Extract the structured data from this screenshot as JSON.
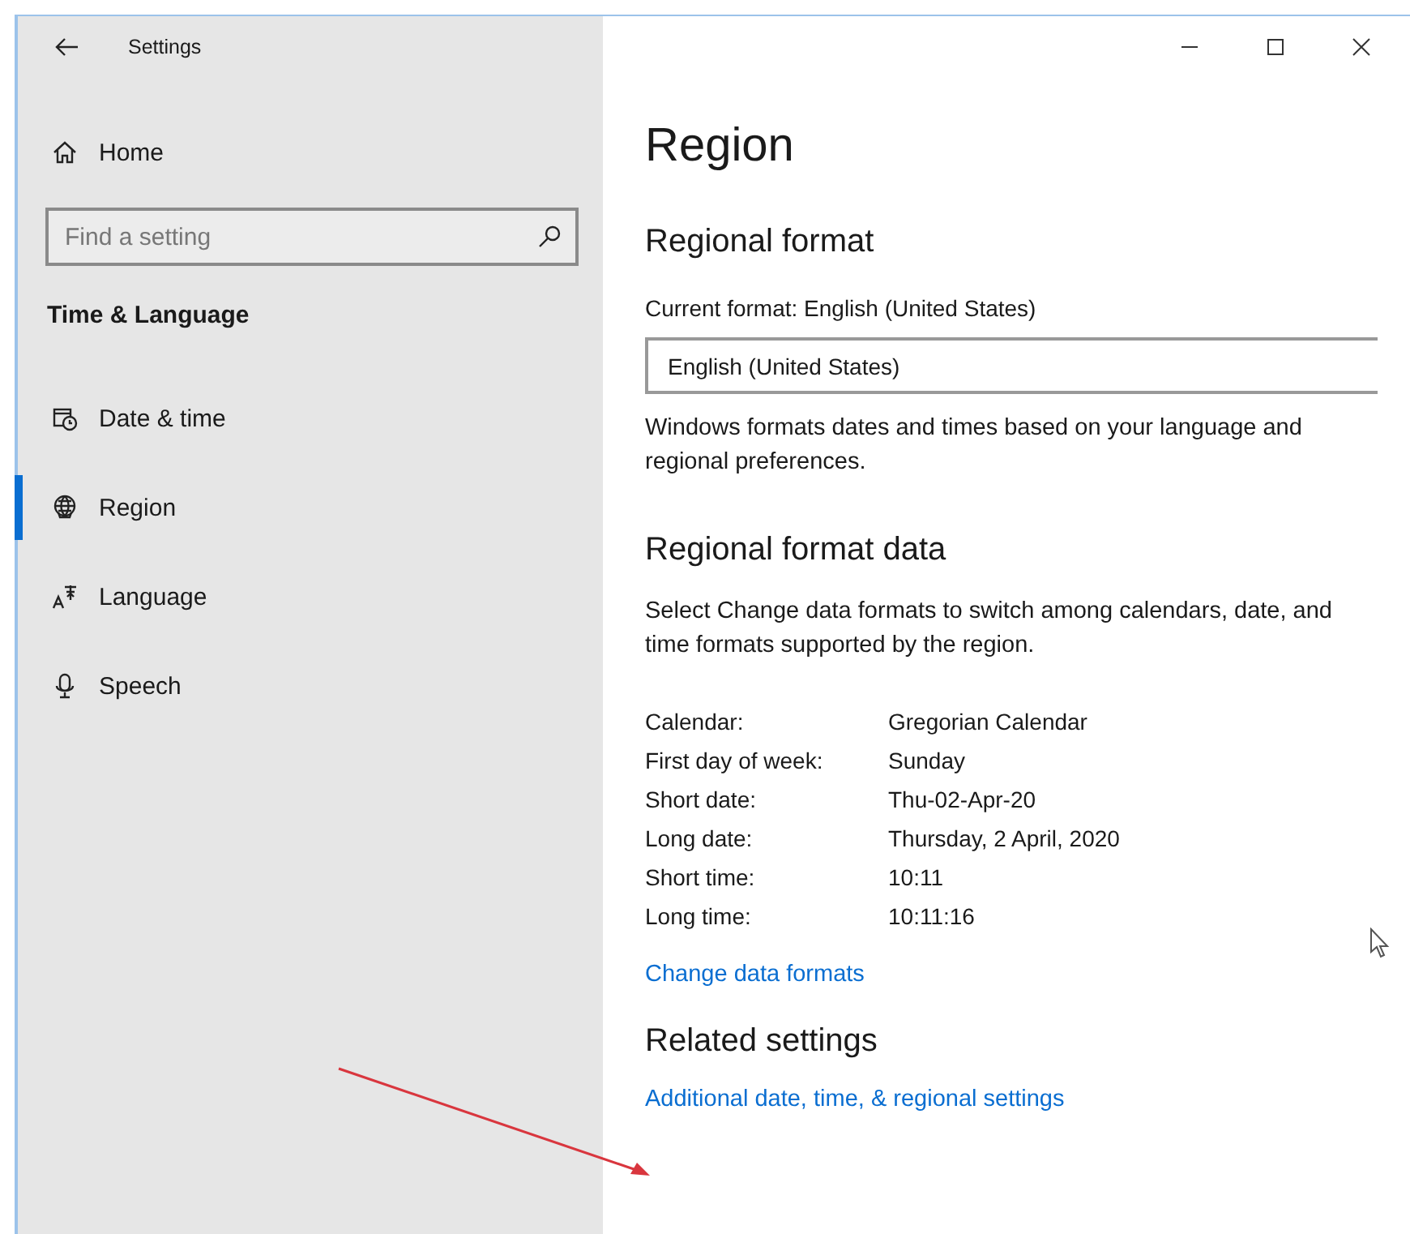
{
  "window": {
    "title": "Settings"
  },
  "sidebar": {
    "home": "Home",
    "search": {
      "placeholder": "Find a setting"
    },
    "section": "Time & Language",
    "items": [
      {
        "label": "Date & time",
        "selected": false
      },
      {
        "label": "Region",
        "selected": true
      },
      {
        "label": "Language",
        "selected": false
      },
      {
        "label": "Speech",
        "selected": false
      }
    ]
  },
  "page": {
    "title": "Region",
    "regional_format": {
      "heading": "Regional format",
      "current": "Current format: English (United States)",
      "dropdown": "English (United States)",
      "description": "Windows formats dates and times based on your language and regional preferences."
    },
    "format_data": {
      "heading": "Regional format data",
      "description": "Select Change data formats to switch among calendars, date, and time formats supported by the region.",
      "rows": [
        {
          "label": "Calendar:",
          "value": "Gregorian Calendar"
        },
        {
          "label": "First day of week:",
          "value": "Sunday"
        },
        {
          "label": "Short date:",
          "value": "Thu-02-Apr-20"
        },
        {
          "label": "Long date:",
          "value": "Thursday, 2 April, 2020"
        },
        {
          "label": "Short time:",
          "value": "10:11"
        },
        {
          "label": "Long time:",
          "value": "10:11:16"
        }
      ],
      "link": "Change data formats"
    },
    "related": {
      "heading": "Related settings",
      "link": "Additional date, time, & regional settings"
    }
  }
}
